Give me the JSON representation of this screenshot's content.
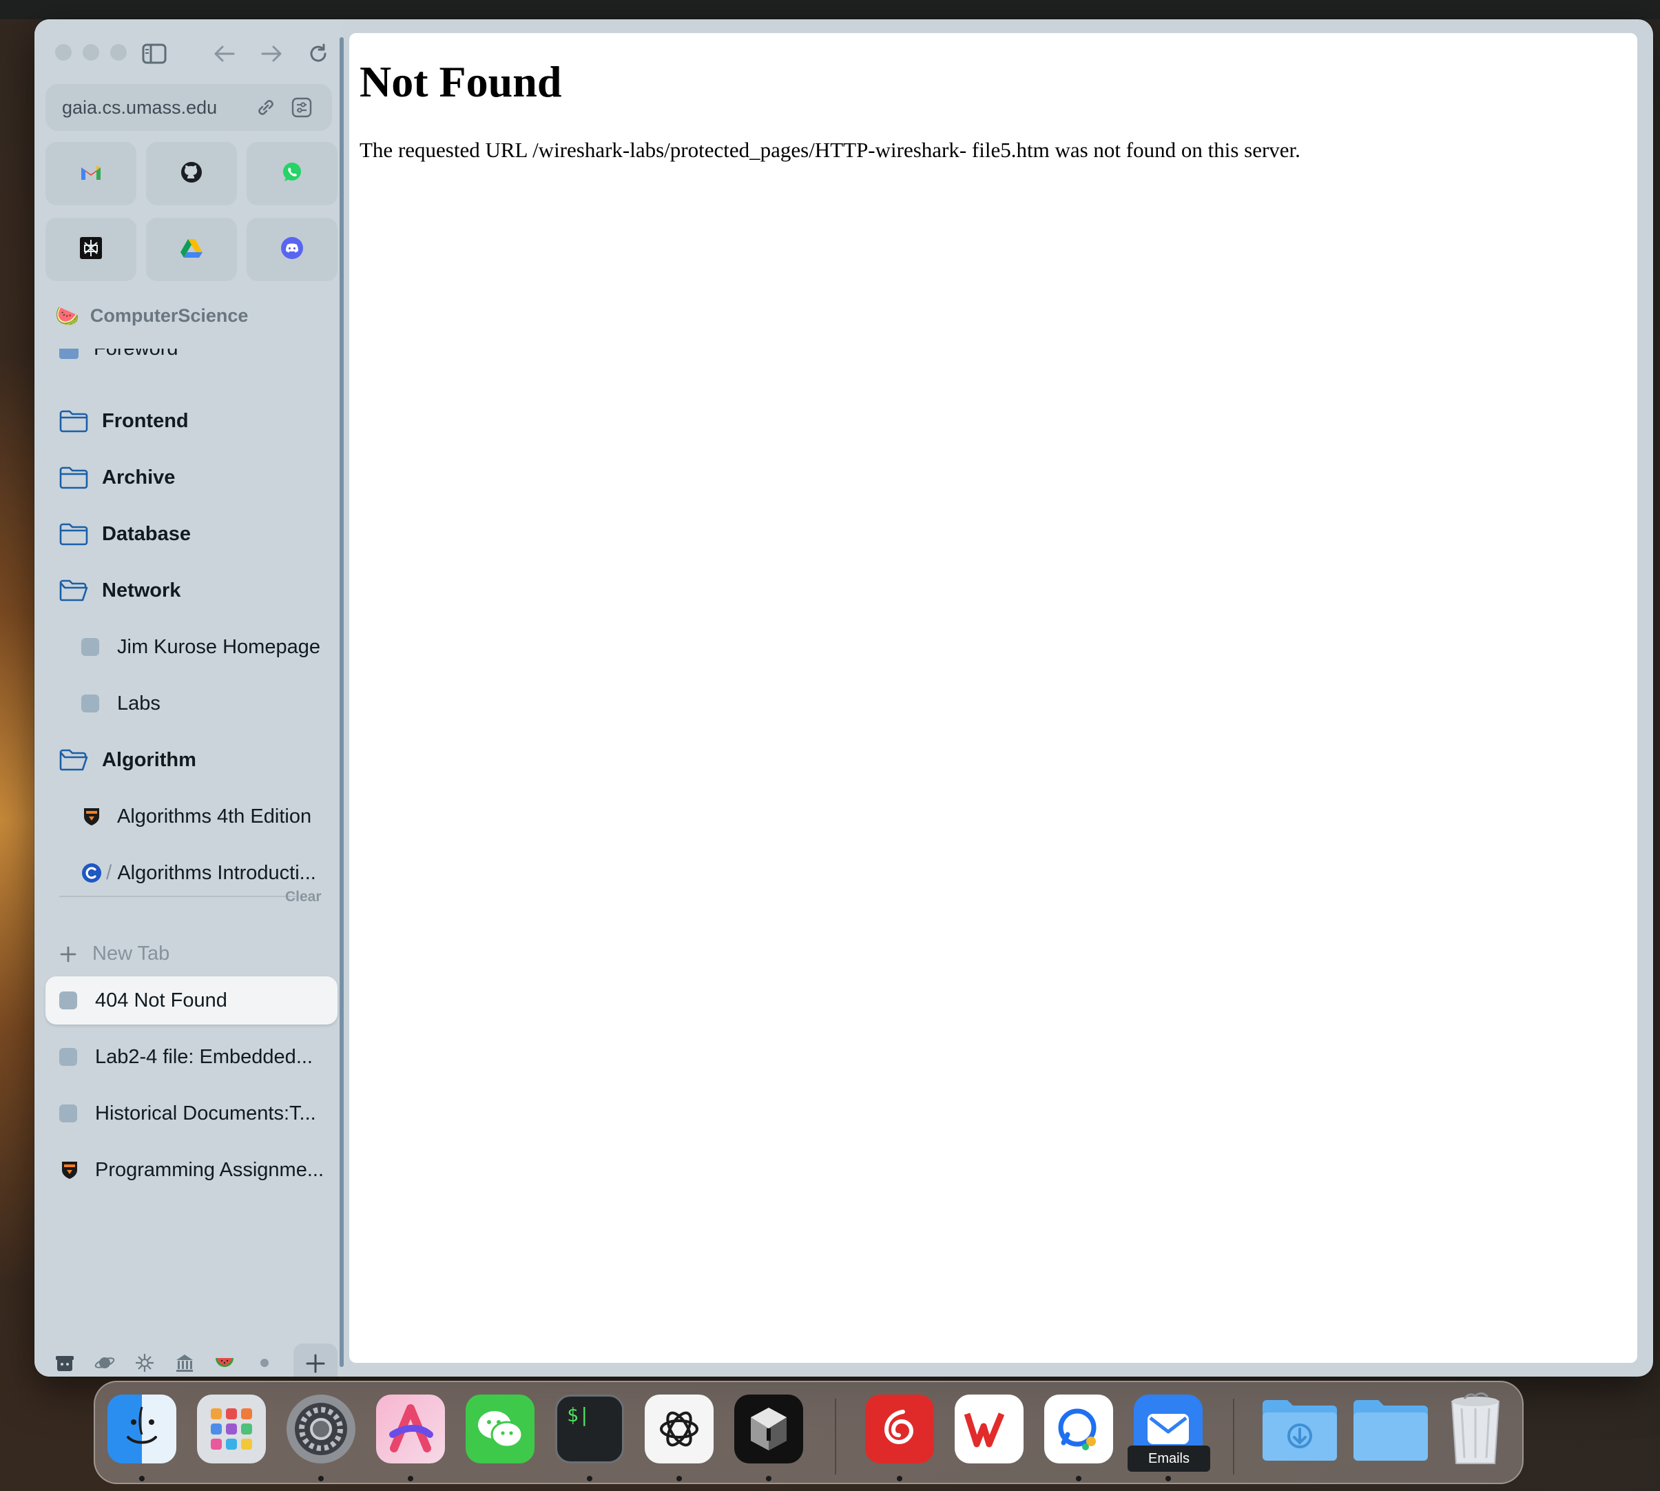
{
  "toolbar": {
    "url": "gaia.cs.umass.edu"
  },
  "pinned": [
    "gmail-icon",
    "github-icon",
    "whatsapp-icon",
    "perplexity-icon",
    "google-drive-icon",
    "discord-icon"
  ],
  "space": {
    "name": "ComputerScience",
    "emoji": "🍉"
  },
  "partial_item": "Foreword",
  "folders": {
    "frontend": "Frontend",
    "archive": "Archive",
    "database": "Database",
    "network": "Network",
    "network_items": [
      "Jim Kurose Homepage",
      "Labs"
    ],
    "algorithm": "Algorithm",
    "algorithm_items": [
      "Algorithms 4th Edition",
      "Algorithms Introducti..."
    ]
  },
  "clear_label": "Clear",
  "new_tab_label": "New Tab",
  "tabs": [
    "404 Not Found",
    "Lab2-4 file: Embedded...",
    "Historical Documents:T...",
    "Programming Assignme..."
  ],
  "page": {
    "heading": "Not Found",
    "message": "The requested URL /wireshark-labs/protected_pages/HTTP-wireshark- file5.htm was not found on this server."
  },
  "dock": {
    "tooltip": "Emails"
  },
  "colors": {
    "sidebar": "#cad4da",
    "accent": "#1a5fa8",
    "page_bg": "#ffffff"
  }
}
